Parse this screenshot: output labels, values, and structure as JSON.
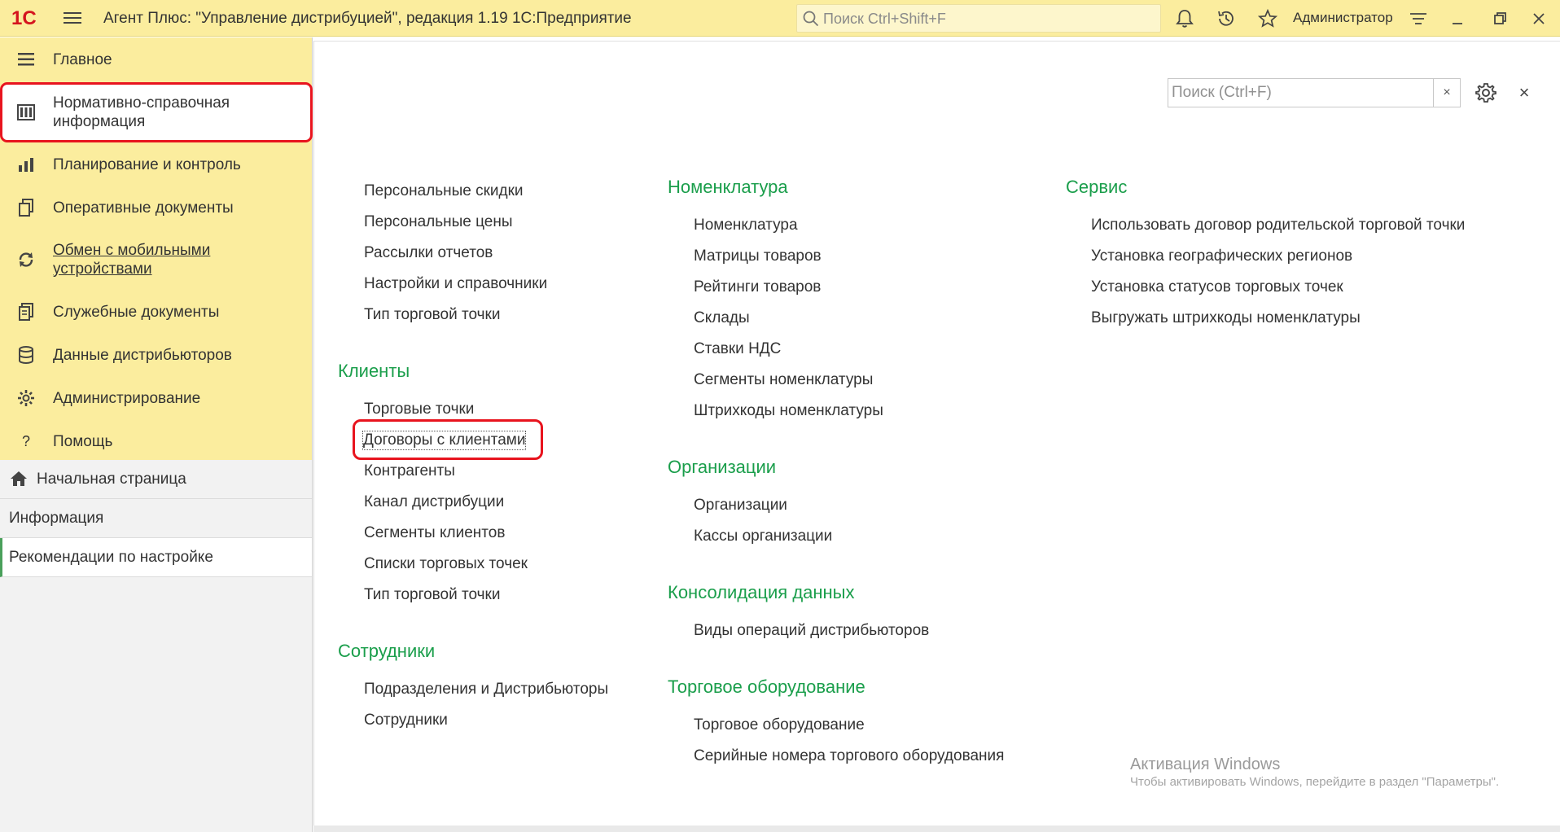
{
  "titlebar": {
    "logo_text": "1С",
    "app_title": "Агент Плюс: \"Управление дистрибуцией\", редакция 1.19 1С:Предприятие",
    "search_placeholder": "Поиск Ctrl+Shift+F",
    "user": "Администратор",
    "icons": [
      "bell-icon",
      "history-icon",
      "star-icon",
      "settings-lines-icon",
      "minimize-icon",
      "restore-icon",
      "close-icon"
    ]
  },
  "sidebar": {
    "sections": [
      {
        "label": "Главное",
        "icon": "menu-lines-icon"
      },
      {
        "label": "Нормативно-справочная информация",
        "icon": "catalog-icon",
        "active": true
      },
      {
        "label": "Планирование и контроль",
        "icon": "chart-icon"
      },
      {
        "label": "Оперативные документы",
        "icon": "documents-icon"
      },
      {
        "label": "Обмен с мобильными устройствами",
        "icon": "sync-icon",
        "link": true
      },
      {
        "label": "Служебные документы",
        "icon": "service-docs-icon"
      },
      {
        "label": "Данные дистрибьюторов",
        "icon": "database-icon"
      },
      {
        "label": "Администрирование",
        "icon": "gear-icon"
      },
      {
        "label": "Помощь",
        "icon": "help-icon"
      }
    ],
    "nav": [
      {
        "label": "Начальная страница",
        "icon": "home-icon"
      },
      {
        "label": "Информация"
      },
      {
        "label": "Рекомендации по настройке",
        "selected": true
      }
    ]
  },
  "panel": {
    "search_placeholder": "Поиск (Ctrl+F)",
    "clear_label": "×",
    "close_label": "×",
    "col1": {
      "top_links": [
        "Персональные скидки",
        "Персональные цены",
        "Рассылки отчетов",
        "Настройки и справочники",
        "Тип торговой точки"
      ],
      "clients_title": "Клиенты",
      "clients_links": [
        "Торговые точки",
        "Договоры с клиентами",
        "Контрагенты",
        "Канал дистрибуции",
        "Сегменты клиентов",
        "Списки торговых точек",
        "Тип торговой точки"
      ],
      "staff_title": "Сотрудники",
      "staff_links": [
        "Подразделения и Дистрибьюторы",
        "Сотрудники"
      ]
    },
    "col2": {
      "nomen_title": "Номенклатура",
      "nomen_links": [
        "Номенклатура",
        "Матрицы товаров",
        "Рейтинги товаров",
        "Склады",
        "Ставки НДС",
        "Сегменты номенклатуры",
        "Штрихкоды номенклатуры"
      ],
      "org_title": "Организации",
      "org_links": [
        "Организации",
        "Кассы организации"
      ],
      "cons_title": "Консолидация данных",
      "cons_links": [
        "Виды операций дистрибьюторов"
      ],
      "equip_title": "Торговое оборудование",
      "equip_links": [
        "Торговое оборудование",
        "Серийные номера торгового оборудования"
      ]
    },
    "col3": {
      "service_title": "Сервис",
      "service_links": [
        "Использовать договор родительской торговой точки",
        "Установка географических регионов",
        "Установка статусов торговых точек",
        "Выгружать штрихкоды номенклатуры"
      ]
    }
  },
  "watermark": {
    "line1": "Активация Windows",
    "line2": "Чтобы активировать Windows, перейдите в раздел \"Параметры\"."
  },
  "colors": {
    "titlebar_bg": "#fbed9e",
    "group_title": "#1a9e4b",
    "highlight_ring": "#e8141e"
  }
}
